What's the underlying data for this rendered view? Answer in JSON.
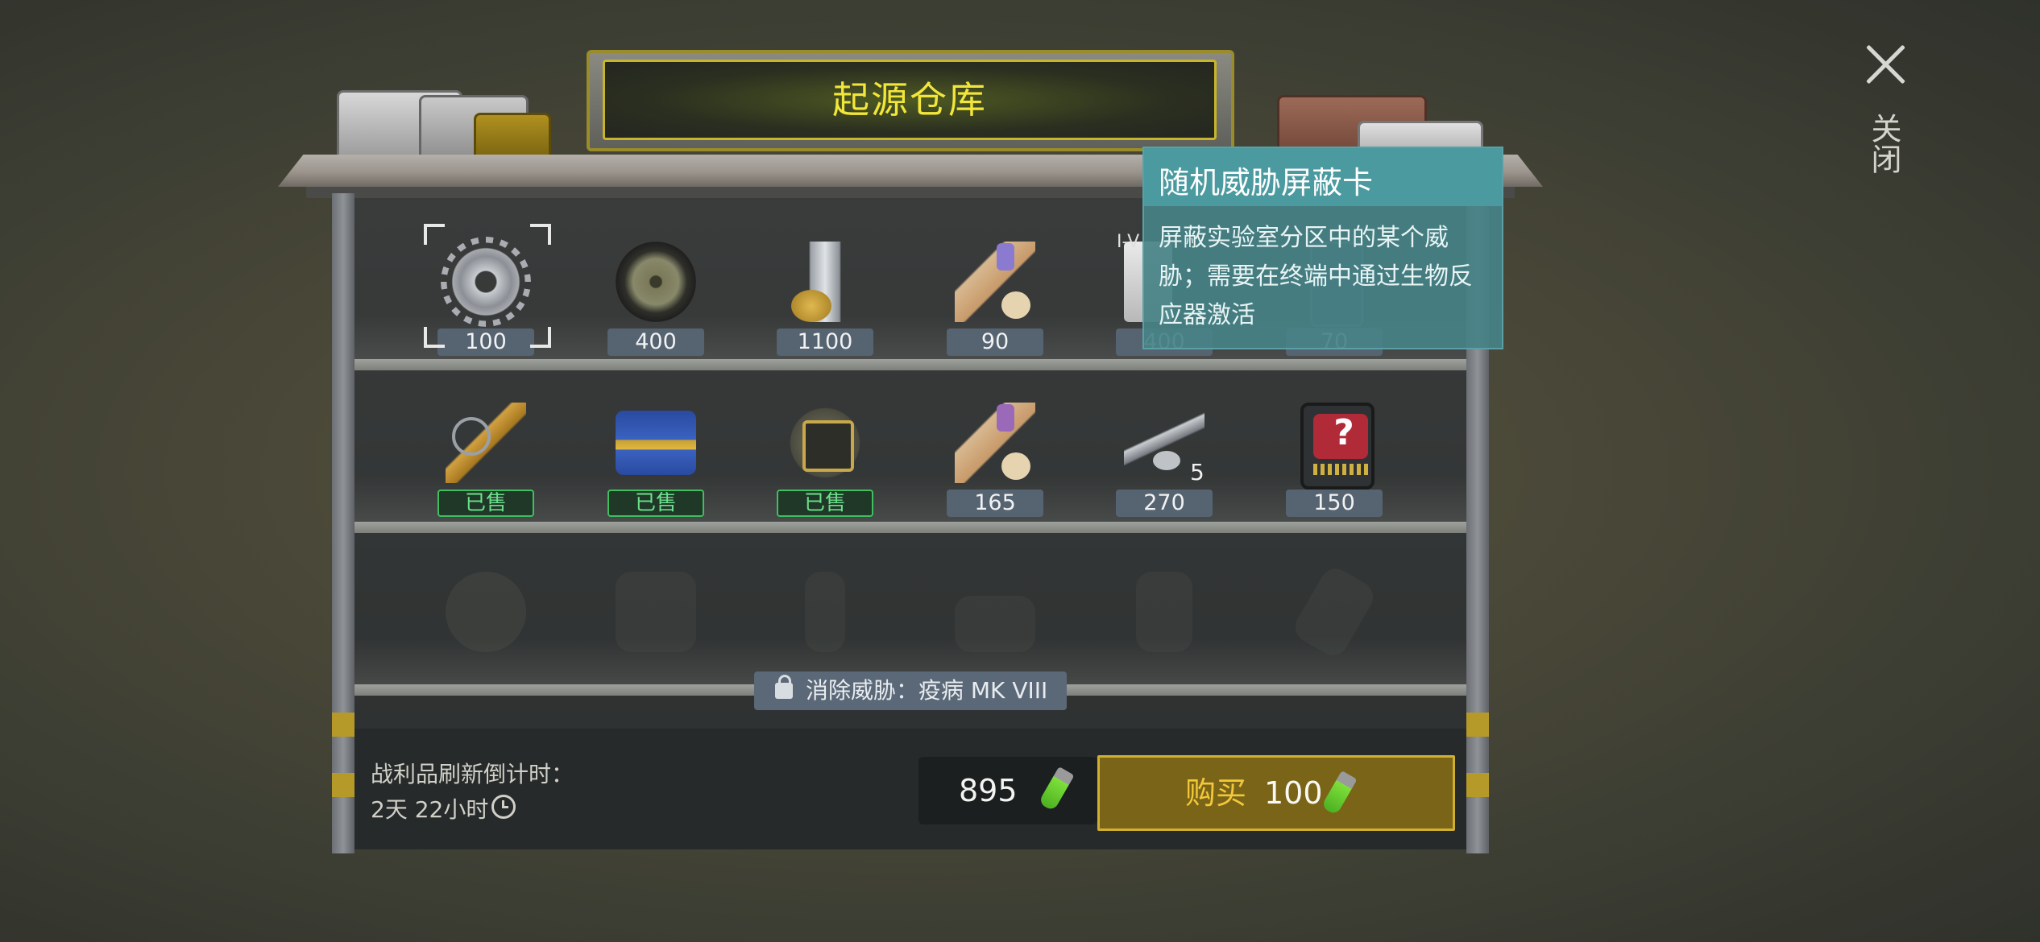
{
  "title": "起源仓库",
  "close_label": "关闭",
  "tooltip": {
    "title": "随机威胁屏蔽卡",
    "description": "屏蔽实验室分区中的某个威胁；需要在终端中通过生物反应器激活"
  },
  "tier_label": "I-V",
  "rows": [
    [
      {
        "icon": "gear-icon",
        "price": "100",
        "sold": false
      },
      {
        "icon": "wheel-icon",
        "price": "400",
        "sold": false
      },
      {
        "icon": "shaft-icon",
        "price": "1100",
        "sold": false
      },
      {
        "icon": "scroll-icon",
        "price": "90",
        "sold": false
      },
      {
        "icon": "box-icon",
        "price": "400",
        "sold": false
      },
      {
        "icon": "chip-icon",
        "price": "70",
        "sold": false
      }
    ],
    [
      {
        "icon": "piston-icon",
        "price": "已售",
        "sold": true
      },
      {
        "icon": "battery-icon",
        "price": "已售",
        "sold": true
      },
      {
        "icon": "circuit-board-icon",
        "price": "已售",
        "sold": true
      },
      {
        "icon": "scroll-icon",
        "price": "165",
        "sold": false
      },
      {
        "icon": "pipe-icon",
        "price": "270",
        "sold": false,
        "qty": "5"
      },
      {
        "icon": "mystery-card-icon",
        "price": "150",
        "sold": false,
        "symbol": "?"
      }
    ]
  ],
  "locked_row_icons": [
    "helmet-icon",
    "vest-icon",
    "pants-icon",
    "boots-icon",
    "gloves-icon",
    "tag-icon"
  ],
  "lock_text": "消除威胁：疫病 MK VIII",
  "refresh": {
    "label": "战利品刷新倒计时：",
    "time": "2天 22小时"
  },
  "balance": "895",
  "buy": {
    "label": "购买",
    "price": "100"
  },
  "colors": {
    "title_text": "#f2e63a",
    "sold_green": "#3fbf5f",
    "buy_gold": "#d0b030",
    "tooltip_teal": "#4a9aa0",
    "currency_green": "#7ee03a"
  }
}
